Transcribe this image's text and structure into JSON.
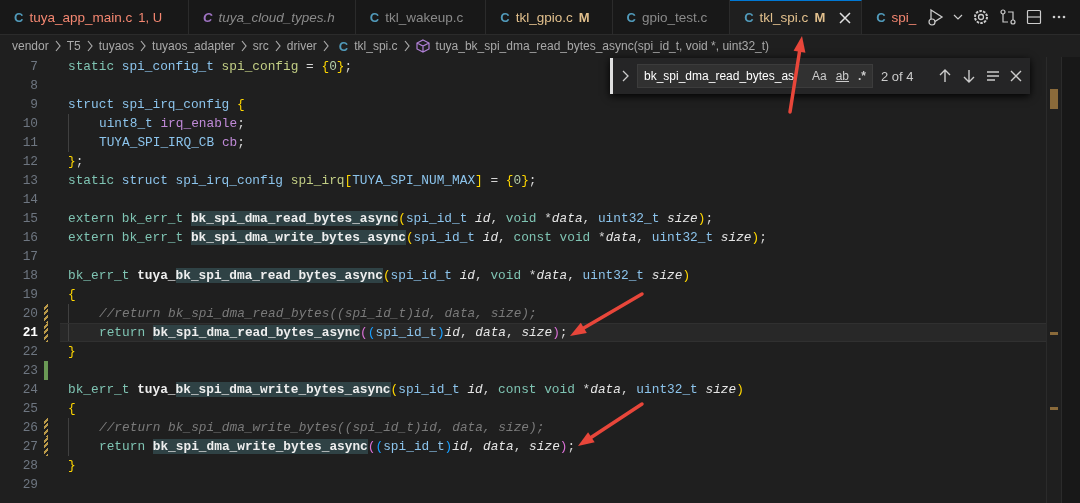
{
  "tabs": [
    {
      "icon": "C",
      "kind": "source",
      "label": "tuya_app_main.c",
      "badge": "1, U",
      "error": true,
      "modified": false,
      "preview": false,
      "selected": false
    },
    {
      "icon": "C",
      "kind": "header",
      "label": "tuya_cloud_types.h",
      "error": false,
      "modified": false,
      "preview": true,
      "selected": false
    },
    {
      "icon": "C",
      "kind": "source",
      "label": "tkl_wakeup.c",
      "error": false,
      "modified": false,
      "preview": false,
      "selected": false
    },
    {
      "icon": "C",
      "kind": "source",
      "label": "tkl_gpio.c",
      "badge": "M",
      "error": false,
      "modified": true,
      "preview": false,
      "selected": false
    },
    {
      "icon": "C",
      "kind": "source",
      "label": "gpio_test.c",
      "error": false,
      "modified": false,
      "preview": false,
      "selected": false
    },
    {
      "icon": "C",
      "kind": "source",
      "label": "tkl_spi.c",
      "badge": "M",
      "error": false,
      "modified": true,
      "preview": false,
      "selected": true
    },
    {
      "icon": "C",
      "kind": "source",
      "label": "spi_",
      "error": true,
      "modified": false,
      "preview": false,
      "selected": false
    }
  ],
  "breadcrumb": [
    {
      "kind": "folder",
      "label": "vendor"
    },
    {
      "kind": "folder",
      "label": "T5"
    },
    {
      "kind": "folder",
      "label": "tuyaos"
    },
    {
      "kind": "folder",
      "label": "tuyaos_adapter"
    },
    {
      "kind": "folder",
      "label": "src"
    },
    {
      "kind": "folder",
      "label": "driver"
    },
    {
      "kind": "file",
      "icon": "C",
      "label": "tkl_spi.c"
    },
    {
      "kind": "symbol",
      "label": "tuya_bk_spi_dma_read_bytes_async(spi_id_t, void *, uint32_t)"
    }
  ],
  "find": {
    "value": "bk_spi_dma_read_bytes_as",
    "options": [
      {
        "kind": "case",
        "label": "Aa",
        "selected": false
      },
      {
        "kind": "word",
        "label": "ab",
        "selected": false
      },
      {
        "kind": "regex",
        "label": ".*",
        "selected": false
      }
    ],
    "count": "2 of 4"
  },
  "lines": [
    {
      "number": "7",
      "current": false,
      "indented": false,
      "modified": false,
      "added": false,
      "tokens": [
        {
          "text": "static ",
          "kind": "keyword"
        },
        {
          "text": "spi_config_t ",
          "kind": "type"
        },
        {
          "text": "spi_config",
          "kind": "variable"
        },
        {
          "text": " = ",
          "kind": "plain"
        },
        {
          "text": "{",
          "kind": "bracket1"
        },
        {
          "text": "0",
          "kind": "number"
        },
        {
          "text": "}",
          "kind": "bracket1"
        },
        {
          "text": ";",
          "kind": "plain"
        }
      ]
    },
    {
      "number": "8",
      "current": false,
      "indented": false,
      "modified": false,
      "added": false
    },
    {
      "number": "9",
      "current": false,
      "indented": false,
      "modified": false,
      "added": false,
      "tokens": [
        {
          "text": "struct ",
          "kind": "type"
        },
        {
          "text": "spi_irq_config ",
          "kind": "type"
        },
        {
          "text": "{",
          "kind": "bracket1"
        }
      ]
    },
    {
      "number": "10",
      "current": false,
      "indented": true,
      "modified": false,
      "added": false,
      "tokens": [
        {
          "text": "uint8_t ",
          "kind": "type"
        },
        {
          "text": "irq_enable",
          "kind": "field"
        },
        {
          "text": ";",
          "kind": "plain"
        }
      ]
    },
    {
      "number": "11",
      "current": false,
      "indented": true,
      "modified": false,
      "added": false,
      "tokens": [
        {
          "text": "TUYA_SPI_IRQ_CB ",
          "kind": "type"
        },
        {
          "text": "cb",
          "kind": "field"
        },
        {
          "text": ";",
          "kind": "plain"
        }
      ]
    },
    {
      "number": "12",
      "current": false,
      "indented": false,
      "modified": false,
      "added": false,
      "tokens": [
        {
          "text": "}",
          "kind": "bracket1"
        },
        {
          "text": ";",
          "kind": "plain"
        }
      ]
    },
    {
      "number": "13",
      "current": false,
      "indented": false,
      "modified": false,
      "added": false,
      "tokens": [
        {
          "text": "static ",
          "kind": "keyword"
        },
        {
          "text": "struct ",
          "kind": "type"
        },
        {
          "text": "spi_irq_config ",
          "kind": "type"
        },
        {
          "text": "spi_irq",
          "kind": "variable"
        },
        {
          "text": "[",
          "kind": "bracket1"
        },
        {
          "text": "TUYA_SPI_NUM_MAX",
          "kind": "type"
        },
        {
          "text": "]",
          "kind": "bracket1"
        },
        {
          "text": " = ",
          "kind": "plain"
        },
        {
          "text": "{",
          "kind": "bracket1"
        },
        {
          "text": "0",
          "kind": "number"
        },
        {
          "text": "}",
          "kind": "bracket1"
        },
        {
          "text": ";",
          "kind": "plain"
        }
      ]
    },
    {
      "number": "14",
      "current": false,
      "indented": false,
      "modified": false,
      "added": false
    },
    {
      "number": "15",
      "current": false,
      "indented": false,
      "modified": false,
      "added": false,
      "tokens": [
        {
          "text": "extern ",
          "kind": "keyword"
        },
        {
          "text": "bk_err_t ",
          "kind": "keyword"
        },
        {
          "text": "bk_spi_dma_read_bytes_async",
          "kind": "function",
          "match": true
        },
        {
          "text": "(",
          "kind": "bracket1"
        },
        {
          "text": "spi_id_t ",
          "kind": "type"
        },
        {
          "text": "id",
          "kind": "param"
        },
        {
          "text": ", ",
          "kind": "plain"
        },
        {
          "text": "void ",
          "kind": "keyword"
        },
        {
          "text": "*",
          "kind": "plain"
        },
        {
          "text": "data",
          "kind": "param"
        },
        {
          "text": ", ",
          "kind": "plain"
        },
        {
          "text": "uint32_t ",
          "kind": "type"
        },
        {
          "text": "size",
          "kind": "param"
        },
        {
          "text": ")",
          "kind": "bracket1"
        },
        {
          "text": ";",
          "kind": "plain"
        }
      ]
    },
    {
      "number": "16",
      "current": false,
      "indented": false,
      "modified": false,
      "added": false,
      "tokens": [
        {
          "text": "extern ",
          "kind": "keyword"
        },
        {
          "text": "bk_err_t ",
          "kind": "keyword"
        },
        {
          "text": "bk_spi_dma_write_bytes_async",
          "kind": "function",
          "match": true
        },
        {
          "text": "(",
          "kind": "bracket1"
        },
        {
          "text": "spi_id_t ",
          "kind": "type"
        },
        {
          "text": "id",
          "kind": "param"
        },
        {
          "text": ", ",
          "kind": "plain"
        },
        {
          "text": "const void ",
          "kind": "keyword"
        },
        {
          "text": "*",
          "kind": "plain"
        },
        {
          "text": "data",
          "kind": "param"
        },
        {
          "text": ", ",
          "kind": "plain"
        },
        {
          "text": "uint32_t ",
          "kind": "type"
        },
        {
          "text": "size",
          "kind": "param"
        },
        {
          "text": ")",
          "kind": "bracket1"
        },
        {
          "text": ";",
          "kind": "plain"
        }
      ]
    },
    {
      "number": "17",
      "current": false,
      "indented": false,
      "modified": false,
      "added": false
    },
    {
      "number": "18",
      "current": false,
      "indented": false,
      "modified": false,
      "added": false,
      "tokens": [
        {
          "text": "bk_err_t ",
          "kind": "keyword"
        },
        {
          "text": "tuya_",
          "kind": "function"
        },
        {
          "text": "bk_spi_dma_read_bytes_async",
          "kind": "function",
          "match": true
        },
        {
          "text": "(",
          "kind": "bracket1"
        },
        {
          "text": "spi_id_t ",
          "kind": "type"
        },
        {
          "text": "id",
          "kind": "param"
        },
        {
          "text": ", ",
          "kind": "plain"
        },
        {
          "text": "void ",
          "kind": "keyword"
        },
        {
          "text": "*",
          "kind": "plain"
        },
        {
          "text": "data",
          "kind": "param"
        },
        {
          "text": ", ",
          "kind": "plain"
        },
        {
          "text": "uint32_t ",
          "kind": "type"
        },
        {
          "text": "size",
          "kind": "param"
        },
        {
          "text": ")",
          "kind": "bracket1"
        }
      ]
    },
    {
      "number": "19",
      "current": false,
      "indented": false,
      "modified": false,
      "added": false,
      "tokens": [
        {
          "text": "{",
          "kind": "bracket1"
        }
      ]
    },
    {
      "number": "20",
      "current": false,
      "indented": true,
      "modified": true,
      "added": false,
      "tokens": [
        {
          "text": "//return bk_spi_dma_read_bytes((spi_id_t)id, data, size);",
          "kind": "comment"
        }
      ]
    },
    {
      "number": "21",
      "current": true,
      "indented": true,
      "modified": true,
      "added": false,
      "tokens": [
        {
          "text": "return ",
          "kind": "keyword"
        },
        {
          "text": "bk_spi_dma_read_bytes_async",
          "kind": "function",
          "match": true
        },
        {
          "text": "(",
          "kind": "bracket2"
        },
        {
          "text": "(",
          "kind": "bracket3"
        },
        {
          "text": "spi_id_t",
          "kind": "type"
        },
        {
          "text": ")",
          "kind": "bracket3"
        },
        {
          "text": "id",
          "kind": "param"
        },
        {
          "text": ", ",
          "kind": "plain"
        },
        {
          "text": "data",
          "kind": "param"
        },
        {
          "text": ", ",
          "kind": "plain"
        },
        {
          "text": "size",
          "kind": "param"
        },
        {
          "text": ")",
          "kind": "bracket2"
        },
        {
          "text": ";",
          "kind": "plain"
        }
      ]
    },
    {
      "number": "22",
      "current": false,
      "indented": false,
      "modified": false,
      "added": false,
      "tokens": [
        {
          "text": "}",
          "kind": "bracket1"
        }
      ]
    },
    {
      "number": "23",
      "current": false,
      "indented": false,
      "modified": false,
      "added": true
    },
    {
      "number": "24",
      "current": false,
      "indented": false,
      "modified": false,
      "added": false,
      "tokens": [
        {
          "text": "bk_err_t ",
          "kind": "keyword"
        },
        {
          "text": "tuya_",
          "kind": "function"
        },
        {
          "text": "bk_spi_dma_write_bytes_async",
          "kind": "function",
          "match": true
        },
        {
          "text": "(",
          "kind": "bracket1"
        },
        {
          "text": "spi_id_t ",
          "kind": "type"
        },
        {
          "text": "id",
          "kind": "param"
        },
        {
          "text": ", ",
          "kind": "plain"
        },
        {
          "text": "const void ",
          "kind": "keyword"
        },
        {
          "text": "*",
          "kind": "plain"
        },
        {
          "text": "data",
          "kind": "param"
        },
        {
          "text": ", ",
          "kind": "plain"
        },
        {
          "text": "uint32_t ",
          "kind": "type"
        },
        {
          "text": "size",
          "kind": "param"
        },
        {
          "text": ")",
          "kind": "bracket1"
        }
      ]
    },
    {
      "number": "25",
      "current": false,
      "indented": false,
      "modified": false,
      "added": false,
      "tokens": [
        {
          "text": "{",
          "kind": "bracket1"
        }
      ]
    },
    {
      "number": "26",
      "current": false,
      "indented": true,
      "modified": true,
      "added": false,
      "tokens": [
        {
          "text": "//return bk_spi_dma_write_bytes((spi_id_t)id, data, size);",
          "kind": "comment"
        }
      ]
    },
    {
      "number": "27",
      "current": false,
      "indented": true,
      "modified": true,
      "added": false,
      "tokens": [
        {
          "text": "return ",
          "kind": "keyword"
        },
        {
          "text": "bk_spi_dma_write_bytes_async",
          "kind": "function",
          "match": true
        },
        {
          "text": "(",
          "kind": "bracket2"
        },
        {
          "text": "(",
          "kind": "bracket3"
        },
        {
          "text": "spi_id_t",
          "kind": "type"
        },
        {
          "text": ")",
          "kind": "bracket3"
        },
        {
          "text": "id",
          "kind": "param"
        },
        {
          "text": ", ",
          "kind": "plain"
        },
        {
          "text": "data",
          "kind": "param"
        },
        {
          "text": ", ",
          "kind": "plain"
        },
        {
          "text": "size",
          "kind": "param"
        },
        {
          "text": ")",
          "kind": "bracket2"
        },
        {
          "text": ";",
          "kind": "plain"
        }
      ]
    },
    {
      "number": "28",
      "current": false,
      "indented": false,
      "modified": false,
      "added": false,
      "tokens": [
        {
          "text": "}",
          "kind": "bracket1"
        }
      ]
    },
    {
      "number": "29",
      "current": false,
      "indented": false,
      "modified": false,
      "added": false
    }
  ]
}
